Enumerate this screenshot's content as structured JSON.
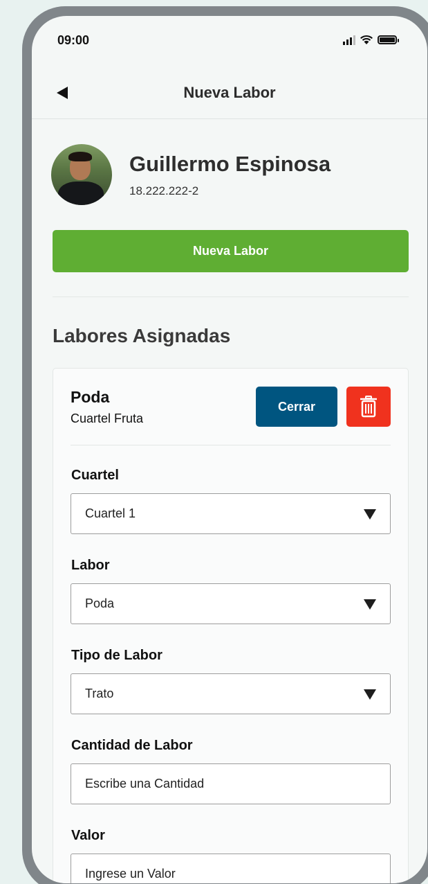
{
  "status_bar": {
    "time": "09:00"
  },
  "header": {
    "title": "Nueva Labor"
  },
  "profile": {
    "name": "Guillermo Espinosa",
    "id": "18.222.222-2"
  },
  "new_labor_button": "Nueva Labor",
  "section_title": "Labores Asignadas",
  "card": {
    "title": "Poda",
    "subtitle": "Cuartel Fruta",
    "close_label": "Cerrar",
    "fields": {
      "cuartel": {
        "label": "Cuartel",
        "value": "Cuartel 1"
      },
      "labor": {
        "label": "Labor",
        "value": "Poda"
      },
      "tipo": {
        "label": "Tipo de Labor",
        "value": "Trato"
      },
      "cantidad": {
        "label": "Cantidad de Labor",
        "placeholder": "Escribe una Cantidad"
      },
      "valor": {
        "label": "Valor",
        "placeholder": "Ingrese un Valor"
      }
    }
  },
  "colors": {
    "primary_green": "#5fae33",
    "close_blue": "#005580",
    "delete_red": "#f0321e"
  }
}
